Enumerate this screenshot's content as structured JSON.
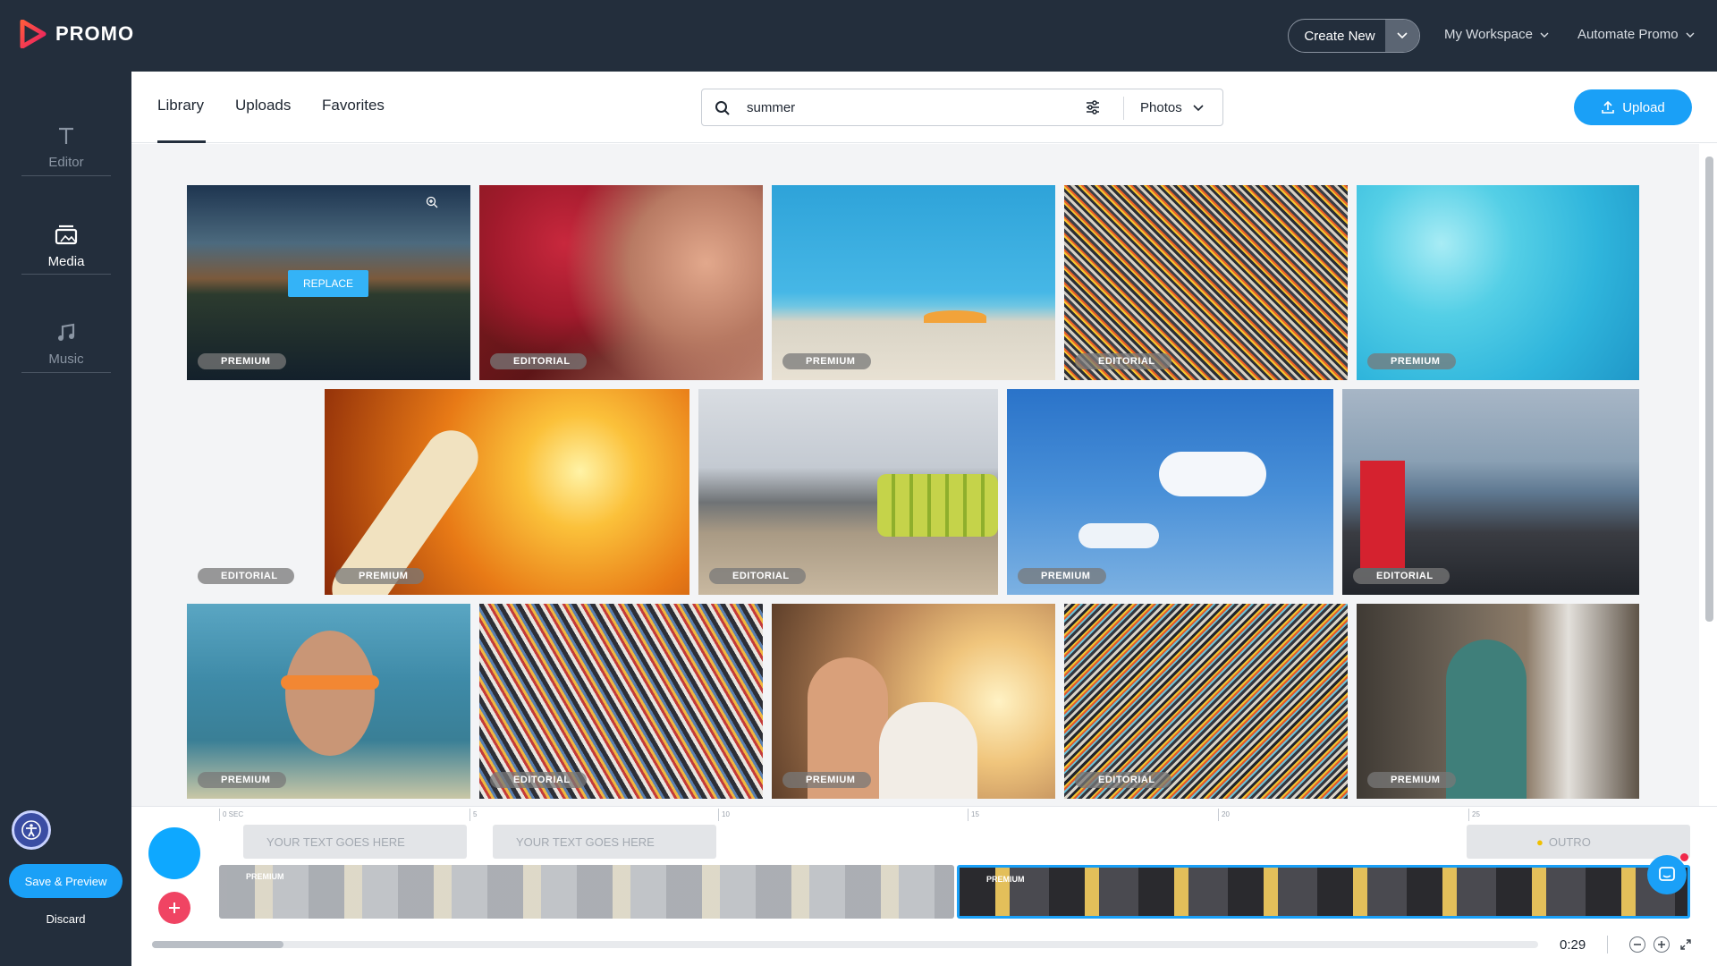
{
  "app": {
    "logo_text": "PROMO"
  },
  "topbar": {
    "create_new": "Create New",
    "workspace": "My Workspace",
    "automate": "Automate Promo"
  },
  "sidebar": {
    "items": [
      {
        "label": "Editor",
        "icon": "text-icon"
      },
      {
        "label": "Media",
        "icon": "media-icon"
      },
      {
        "label": "Music",
        "icon": "music-icon"
      }
    ],
    "save_preview": "Save & Preview",
    "discard": "Discard"
  },
  "tabs": [
    "Library",
    "Uploads",
    "Favorites"
  ],
  "search": {
    "value": "summer",
    "type": "Photos"
  },
  "upload_label": "Upload",
  "replace_label": "REPLACE",
  "thumbnails": [
    {
      "badge": "PREMIUM",
      "subject": "canal houses at dusk"
    },
    {
      "badge": "EDITORIAL",
      "subject": "man in cap and sunglasses"
    },
    {
      "badge": "PREMIUM",
      "subject": "beach with umbrella"
    },
    {
      "badge": "EDITORIAL",
      "subject": "crowded beach"
    },
    {
      "badge": "PREMIUM",
      "subject": "pool water"
    },
    {
      "badge": "EDITORIAL",
      "subject": ""
    },
    {
      "badge": "PREMIUM",
      "subject": "thermometer in sun"
    },
    {
      "badge": "EDITORIAL",
      "subject": "crowd on beach with floats"
    },
    {
      "badge": "PREMIUM",
      "subject": "blue sky with clouds"
    },
    {
      "badge": "EDITORIAL",
      "subject": "crowd by the sea"
    },
    {
      "badge": "PREMIUM",
      "subject": "girl with goggles in water"
    },
    {
      "badge": "EDITORIAL",
      "subject": "crowd taking selfies"
    },
    {
      "badge": "PREMIUM",
      "subject": "couple near colosseum"
    },
    {
      "badge": "EDITORIAL",
      "subject": "crowded beach"
    },
    {
      "badge": "PREMIUM",
      "subject": "woman at cafe table"
    }
  ],
  "timeline": {
    "ticks": [
      "0 SEC",
      "5",
      "10",
      "15",
      "20",
      "25"
    ],
    "text_tracks": [
      "YOUR TEXT GOES HERE",
      "YOUR TEXT GOES HERE"
    ],
    "outro": "OUTRO",
    "clip_badges": [
      "PREMIUM",
      "PREMIUM"
    ],
    "duration": "0:29"
  }
}
